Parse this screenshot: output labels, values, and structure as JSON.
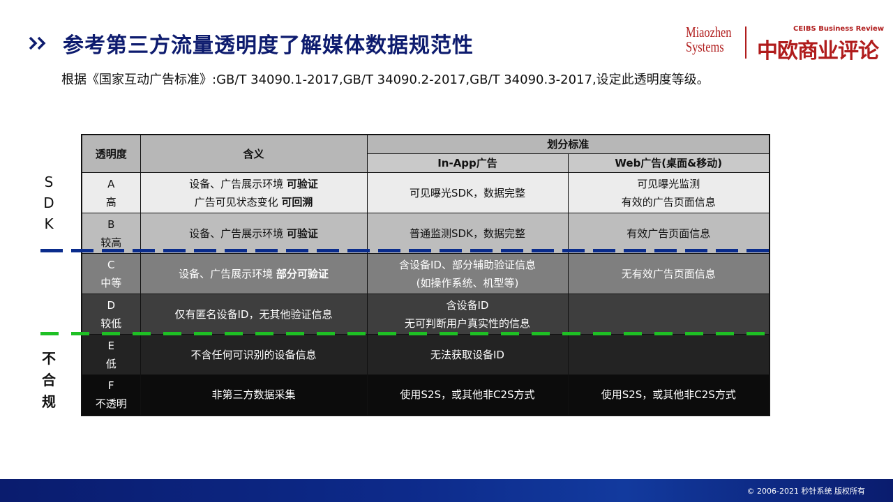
{
  "header": {
    "title": "参考第三方流量透明度了解媒体数据规范性",
    "subtitle": "根据《国家互动广告标准》:GB/T 34090.1-2017,GB/T 34090.2-2017,GB/T 34090.3-2017,设定此透明度等级。"
  },
  "logos": {
    "miaozhen_line1": "Miaozhen",
    "miaozhen_line2": "Systems",
    "ceibs_en": "CEIBS Business Review",
    "ceibs_cn": "中欧商业评论"
  },
  "side_labels": {
    "sdk": [
      "S",
      "D",
      "K"
    ],
    "noncompliant": [
      "不",
      "合",
      "规"
    ]
  },
  "table": {
    "headers": {
      "level": "透明度",
      "meaning": "含义",
      "criteria": "划分标准",
      "inapp": "In-App广告",
      "web": "Web广告(桌面&移动)"
    },
    "rows": [
      {
        "grade": "A",
        "grade_label": "高",
        "meaning_l1_pre": "设备、广告展示环境 ",
        "meaning_l1_bold": "可验证",
        "meaning_l2_pre": "广告可见状态变化 ",
        "meaning_l2_bold": "可回溯",
        "inapp": [
          "可见曝光SDK，数据完整"
        ],
        "web": [
          "可见曝光监测",
          "有效的广告页面信息"
        ]
      },
      {
        "grade": "B",
        "grade_label": "较高",
        "meaning_l1_pre": "设备、广告展示环境 ",
        "meaning_l1_bold": "可验证",
        "inapp": [
          "普通监测SDK，数据完整"
        ],
        "web": [
          "有效广告页面信息"
        ]
      },
      {
        "grade": "C",
        "grade_label": "中等",
        "meaning_l1_pre": "设备、广告展示环境 ",
        "meaning_l1_bold": "部分可验证",
        "inapp": [
          "含设备ID、部分辅助验证信息",
          "(如操作系统、机型等)"
        ],
        "web": [
          "无有效广告页面信息"
        ]
      },
      {
        "grade": "D",
        "grade_label": "较低",
        "meaning_l1_pre": "仅有匿名设备ID，无其他验证信息",
        "inapp": [
          "含设备ID",
          "无可判断用户真实性的信息"
        ],
        "web": []
      },
      {
        "grade": "E",
        "grade_label": "低",
        "meaning_l1_pre": "不含任何可识别的设备信息",
        "inapp": [
          "无法获取设备ID"
        ],
        "web": []
      },
      {
        "grade": "F",
        "grade_label": "不透明",
        "meaning_l1_pre": "非第三方数据采集",
        "inapp": [
          "使用S2S，或其他非C2S方式"
        ],
        "web": [
          "使用S2S，或其他非C2S方式"
        ]
      }
    ]
  },
  "footer": {
    "copyright": "© 2006-2021 秒针系统 版权所有"
  },
  "colors": {
    "title": "#0d1b6e",
    "brand_red": "#b01c1c",
    "sdk_line": "#0a2c8c",
    "noncompliant_line": "#1ec024",
    "footer_bg": "#0d2a8a"
  }
}
